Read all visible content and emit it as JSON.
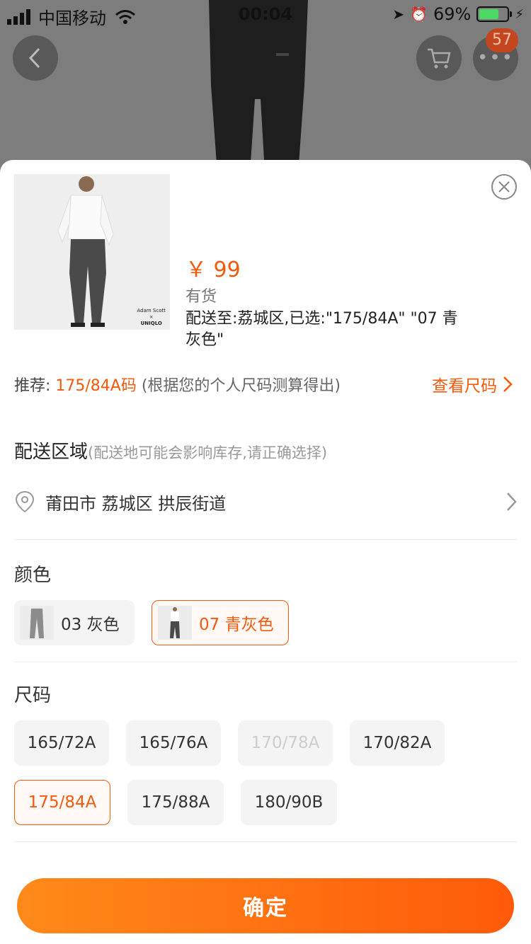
{
  "status_bar": {
    "carrier": "中国移动",
    "time": "00:04",
    "battery": "69%"
  },
  "header": {
    "cart_badge": "57"
  },
  "product": {
    "price": "￥ 99",
    "stock": "有货",
    "shipping": "配送至:荔城区,已选:\"175/84A\" \"07 青灰色\"",
    "image_caption_line1": "Adam Scott",
    "image_caption_line2": "×",
    "image_caption_line3": "UNIQLO"
  },
  "recommend": {
    "prefix": "推荐: ",
    "size": "175/84A码",
    "note": " (根据您的个人尺码测算得出)",
    "size_link": "查看尺码"
  },
  "delivery": {
    "title": "配送区域",
    "hint": "(配送地可能会影响库存,请正确选择)",
    "address": "莆田市 荔城区 拱辰街道"
  },
  "color": {
    "title": "颜色",
    "options": [
      {
        "label": "03 灰色",
        "selected": false
      },
      {
        "label": "07 青灰色",
        "selected": true
      }
    ]
  },
  "size": {
    "title": "尺码",
    "options": [
      {
        "label": "165/72A",
        "state": "normal"
      },
      {
        "label": "165/76A",
        "state": "normal"
      },
      {
        "label": "170/78A",
        "state": "disabled"
      },
      {
        "label": "170/82A",
        "state": "normal"
      },
      {
        "label": "175/84A",
        "state": "selected"
      },
      {
        "label": "175/88A",
        "state": "normal"
      },
      {
        "label": "180/90B",
        "state": "normal"
      }
    ]
  },
  "confirm_label": "确定",
  "colors": {
    "accent": "#f25a0e",
    "button_start": "#ff8a1a",
    "button_end": "#ff5a0a"
  }
}
